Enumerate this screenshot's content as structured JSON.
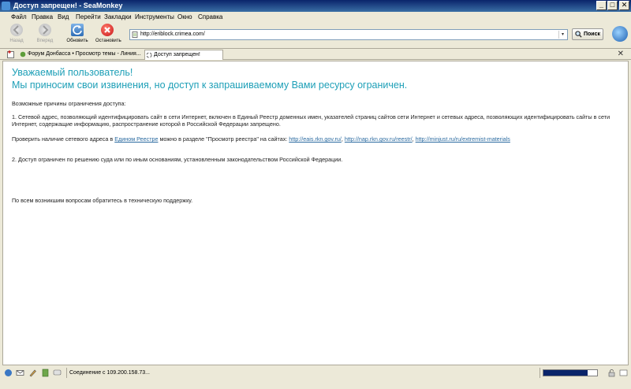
{
  "window": {
    "title": "Доступ запрещен! - SeaMonkey",
    "min": "_",
    "max": "□",
    "close": "✕"
  },
  "menu": [
    "Файл",
    "Правка",
    "Вид",
    "Перейти",
    "Закладки",
    "Инструменты",
    "Окно",
    "Справка"
  ],
  "nav": {
    "back": "Назад",
    "forward": "Вперед",
    "reload": "Обновить",
    "stop": "Остановить",
    "url": "http://eriblock.crimea.com/",
    "search": "Поиск"
  },
  "tabs": [
    {
      "label": "Форум Донбасса • Просмотр темы - Линия..."
    },
    {
      "label": "Доступ запрещен!"
    }
  ],
  "page": {
    "heading1": "Уважаемый пользователь!",
    "heading2": "Мы приносим свои извинения, но доступ к запрашиваемому Вами ресурсу ограничен.",
    "reasons_title": "Возможные причины ограничения доступа:",
    "reason1": "1. Сетевой адрес, позволяющий идентифицировать сайт в сети Интернет, включен в Единый Реестр доменных имен, указателей страниц сайтов сети Интернет и сетевых адреса, позволяющих идентифицировать сайты в сети Интернет, содержащие информацию, распространение которой в Российской Федерации запрещено.",
    "check_prefix": "Проверить наличие сетевого адреса в ",
    "registry_link": "Едином Реестре",
    "check_mid": " можно в разделе \"Просмотр реестра\" на сайтах: ",
    "link1": "http://eais.rkn.gov.ru/",
    "link2": "http://nap.rkn.gov.ru/reestr/",
    "link3": "http://minjust.ru/ru/extremist-materials",
    "sep": ", ",
    "reason2": "2. Доступ ограничен по решению суда или по иным основаниям, установленным законодательством Российской Федерации.",
    "support": "По всем возникшим вопросам обратитесь в техническую поддержку."
  },
  "status": {
    "text": "Соединение с 109.200.158.73...",
    "progress": 0.82
  }
}
